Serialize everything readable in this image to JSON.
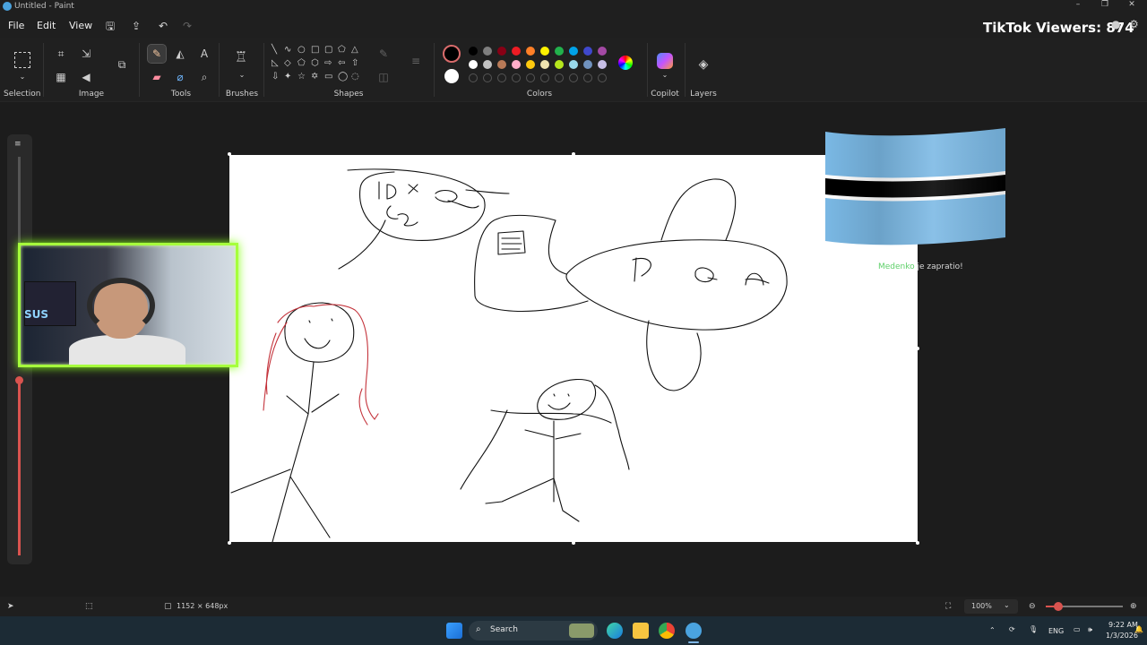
{
  "window": {
    "title": "Untitled - Paint"
  },
  "menu": {
    "file": "File",
    "edit": "Edit",
    "view": "View"
  },
  "overlay": {
    "viewers": "TikTok Viewers: 874",
    "follow_name": "Medenko",
    "follow_text": " je zapratio!"
  },
  "ribbon": {
    "groups": {
      "selection": "Selection",
      "image": "Image",
      "tools": "Tools",
      "brushes": "Brushes",
      "shapes": "Shapes",
      "colors": "Colors",
      "copilot": "Copilot",
      "layers": "Layers"
    },
    "palette_row1": [
      "#000000",
      "#7f7f7f",
      "#880015",
      "#ed1c24",
      "#ff7f27",
      "#fff200",
      "#22b14c",
      "#00a2e8",
      "#3f48cc",
      "#a349a4"
    ],
    "palette_row2": [
      "#ffffff",
      "#c3c3c3",
      "#b97a57",
      "#ffaec9",
      "#ffc90e",
      "#efe4b0",
      "#b5e61d",
      "#99d9ea",
      "#7092be",
      "#c8bfe7"
    ],
    "primary_color": "#000000",
    "secondary_color": "#ffffff"
  },
  "status": {
    "canvas_size": "1152 × 648px",
    "zoom": "100%"
  },
  "taskbar": {
    "search": "Search",
    "lang": "ENG",
    "time": "9:22 AM",
    "date": "1/3/2026"
  }
}
